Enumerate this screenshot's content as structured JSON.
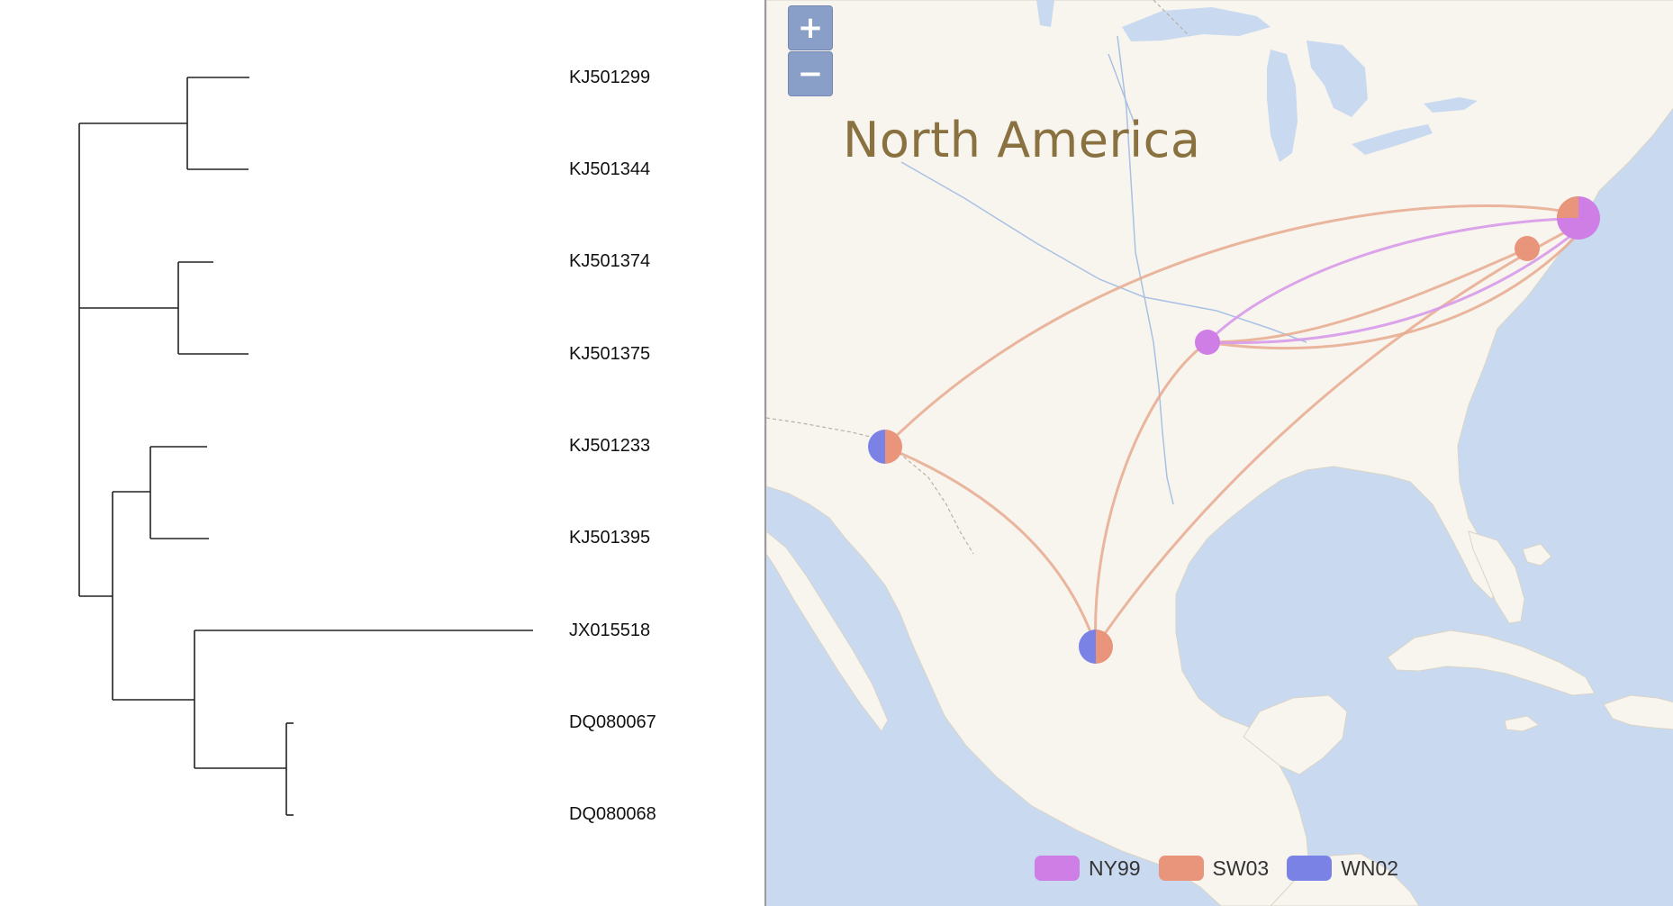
{
  "tree": {
    "leaves": [
      {
        "label": "KJ501299"
      },
      {
        "label": "KJ501344"
      },
      {
        "label": "KJ501374"
      },
      {
        "label": "KJ501375"
      },
      {
        "label": "KJ501233"
      },
      {
        "label": "KJ501395"
      },
      {
        "label": "JX015518"
      },
      {
        "label": "DQ080067"
      },
      {
        "label": "DQ080068"
      }
    ]
  },
  "map": {
    "zoom_in_label": "+",
    "zoom_out_label": "−",
    "region_label": "North America",
    "legend": [
      {
        "label": "NY99",
        "color": "#cf7ee6"
      },
      {
        "label": "SW03",
        "color": "#e8957c"
      },
      {
        "label": "WN02",
        "color": "#7b82e6"
      }
    ]
  }
}
